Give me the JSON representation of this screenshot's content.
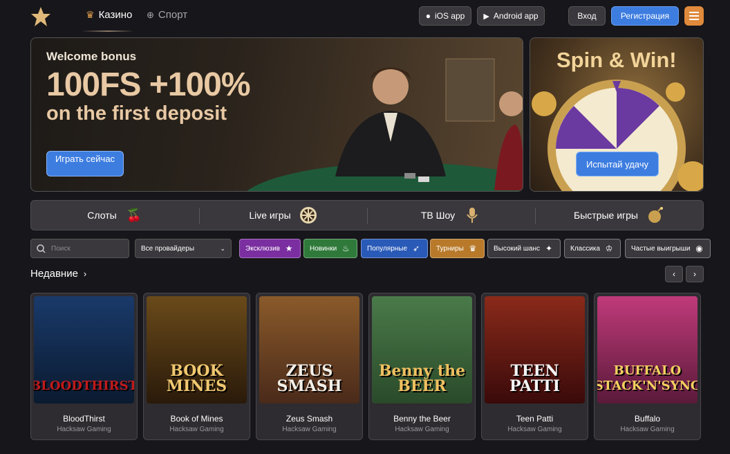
{
  "header": {
    "nav": [
      {
        "label": "Казино"
      },
      {
        "label": "Спорт"
      }
    ],
    "ios_label": "iOS app",
    "android_label": "Android app",
    "login_label": "Вход",
    "register_label": "Регистрация"
  },
  "banner": {
    "subtitle": "Welcome bonus",
    "title": "100FS +100%",
    "title2": "on the first deposit",
    "button": "Играть сейчас"
  },
  "spin": {
    "title": "Spin & Win!",
    "button": "Испытай удачу"
  },
  "categories": [
    {
      "label": "Слоты",
      "icon": "cherry-icon"
    },
    {
      "label": "Live игры",
      "icon": "roulette-icon"
    },
    {
      "label": "ТВ Шоу",
      "icon": "microphone-icon"
    },
    {
      "label": "Быстрые игры",
      "icon": "bomb-icon"
    }
  ],
  "search": {
    "placeholder": "Поиск"
  },
  "providers": {
    "value": "Все провайдеры"
  },
  "filters": [
    {
      "label": "Эксклюзив",
      "color": "#7a2ea0"
    },
    {
      "label": "Новинки",
      "color": "#2f7a3a"
    },
    {
      "label": "Популярные",
      "color": "#2a5ab8"
    },
    {
      "label": "Турниры",
      "color": "#b87a2a"
    },
    {
      "label": "Высокий шанс",
      "color": "#3a383c"
    },
    {
      "label": "Классика",
      "color": "#3a383c"
    },
    {
      "label": "Частые выигрыши",
      "color": "#3a383c"
    }
  ],
  "section": {
    "title": "Недавние"
  },
  "games": [
    {
      "name": "BloodThirst",
      "provider": "Hacksaw Gaming",
      "art": "BLOODTHIRST"
    },
    {
      "name": "Book of Mines",
      "provider": "Hacksaw Gaming",
      "art": "BOOK MINES"
    },
    {
      "name": "Zeus Smash",
      "provider": "Hacksaw Gaming",
      "art": "ZEUS SMASH"
    },
    {
      "name": "Benny the Beer",
      "provider": "Hacksaw Gaming",
      "art": "Benny the BEER"
    },
    {
      "name": "Teen Patti",
      "provider": "Hacksaw Gaming",
      "art": "TEEN PATTI"
    },
    {
      "name": "Buffalo",
      "provider": "Hacksaw Gaming",
      "art": "BUFFALO STACK'N'SYNC"
    }
  ]
}
